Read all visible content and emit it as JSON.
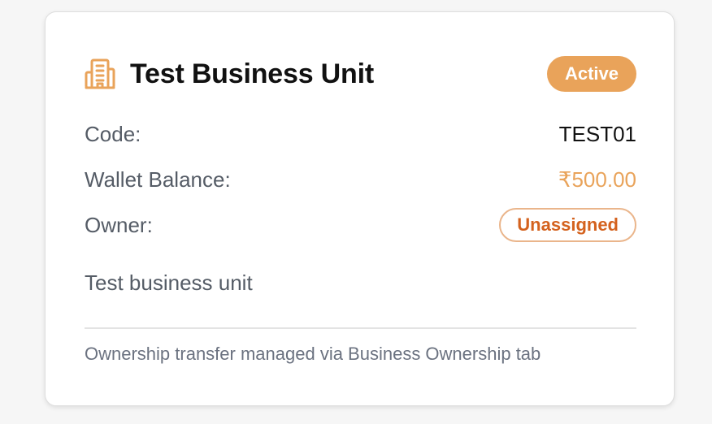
{
  "card": {
    "icon": "building-icon",
    "title": "Test Business Unit",
    "status": "Active",
    "fields": {
      "code_label": "Code:",
      "code_value": "TEST01",
      "wallet_label": "Wallet Balance:",
      "wallet_value": "₹500.00",
      "owner_label": "Owner:",
      "owner_value": "Unassigned"
    },
    "description": "Test business unit",
    "footnote": "Ownership transfer managed via Business Ownership tab"
  },
  "colors": {
    "accent": "#e9a35a",
    "owner_text": "#d4621e",
    "owner_border": "#eab58b"
  }
}
